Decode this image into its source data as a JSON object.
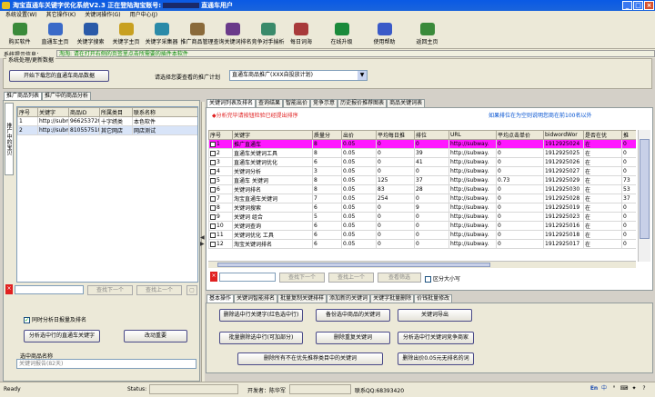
{
  "window": {
    "title": "淘宝直通车关键字优化系统V2.3  正在登陆淘宝账号:",
    "user_label": "直通车用户"
  },
  "menu": [
    "系统设置(W)",
    "其它操作(K)",
    "关键词操作(G)",
    "用户中心(J)"
  ],
  "toolbar": [
    {
      "label": "购买软件",
      "icon": "shopping-cart-icon",
      "color": "#3a8a3a"
    },
    {
      "label": "直通车主页",
      "icon": "home-icon",
      "color": "#3a6ac8"
    },
    {
      "label": "关键字搜索",
      "icon": "search-icon",
      "color": "#2a5aa8"
    },
    {
      "label": "关键字主页",
      "icon": "key-icon",
      "color": "#c8a020"
    },
    {
      "label": "关键字采集器",
      "icon": "collector-icon",
      "color": "#2a8aa8"
    },
    {
      "label": "推广商品管理",
      "icon": "product-icon",
      "color": "#8a6a3a"
    },
    {
      "label": "查询关键词排名",
      "icon": "rank-icon",
      "color": "#6a3a8a"
    },
    {
      "label": "竞争对手揣析",
      "icon": "competitor-icon",
      "color": "#3a8a6a"
    },
    {
      "label": "每日词海",
      "icon": "dictionary-icon",
      "color": "#a83a3a"
    },
    {
      "label": "在线升级",
      "icon": "upgrade-icon",
      "color": "#1a8a3a"
    },
    {
      "label": "使用帮助",
      "icon": "help-icon",
      "color": "#3a5ac8"
    },
    {
      "label": "返回主页",
      "icon": "return-home-icon",
      "color": "#3a8a3a"
    }
  ],
  "infobar": {
    "label": "系统提示信息：",
    "message": "淘淘: 请在打开右侧的页签里点击所需要的插件本软件"
  },
  "sync_group": {
    "label": "系统处理/更新数据",
    "sync_button": "开始下载您的直通车商品数据",
    "plan_label": "请选择您要查看的推广计划",
    "plan_value": "直通车商品推广(XXX自投放计划)"
  },
  "left_tabs": [
    "推广商品列表",
    "推广中的商品分析"
  ],
  "left_vtab": "推广中的宝贝",
  "product_table": {
    "headers": [
      "序号",
      "关键字",
      "商品ID",
      "所属类目",
      "联系名称"
    ],
    "rows": [
      [
        "1",
        "http://subm",
        "966253720",
        "十字绣类",
        "本色软件"
      ],
      [
        "2",
        "http://subm",
        "810557510",
        "其它网店",
        "网店测试"
      ]
    ]
  },
  "left_search": {
    "prev": "查找下一个",
    "next": "查找上一个"
  },
  "left_controls": {
    "checkbox_label": "同时分析日报量及排名",
    "analyze_button": "分析选中行的直通车关键字",
    "stop_button": "改动重要",
    "selected_label": "选中商品名称",
    "selected_value": "关键词报告(82天)"
  },
  "main_tabs": [
    "关键词列表及排名",
    "查询结果",
    "智能出价",
    "竞争示意",
    "历史报价推荐图表",
    "商品关键词表"
  ],
  "notice_left": "分析完毕请按钮检验已经提出排序",
  "notice_right": "如果排位在为空则说明您商在前100名以外",
  "keyword_table": {
    "headers": [
      "序号",
      "关键字",
      "质量分",
      "出价",
      "平均每日推",
      "排位",
      "URL",
      "平均点击单价",
      "bidwordWor",
      "是否在优",
      "推"
    ],
    "rows": [
      [
        "1",
        "推广直通车",
        "8",
        "0.05",
        "0",
        "0",
        "http://subway.",
        "0",
        "1912925024",
        "在",
        "0"
      ],
      [
        "2",
        "直通车关键词工具",
        "8",
        "0.05",
        "0",
        "39",
        "http://subway.",
        "0",
        "1912925025",
        "在",
        "0"
      ],
      [
        "3",
        "直通车关键词优化",
        "6",
        "0.05",
        "0",
        "41",
        "http://subway.",
        "0",
        "1912925026",
        "在",
        "0"
      ],
      [
        "4",
        "关键词分析",
        "3",
        "0.05",
        "0",
        "0",
        "http://subway.",
        "0",
        "1912925027",
        "在",
        "0"
      ],
      [
        "5",
        "直通车 关键词",
        "8",
        "0.05",
        "125",
        "37",
        "http://subway.",
        "0.73",
        "1912925029",
        "在",
        "73"
      ],
      [
        "6",
        "关键词排名",
        "8",
        "0.05",
        "83",
        "28",
        "http://subway.",
        "0",
        "1912925030",
        "在",
        "53"
      ],
      [
        "7",
        "淘宝直通车关键词",
        "7",
        "0.05",
        "254",
        "0",
        "http://subway.",
        "0",
        "1912925028",
        "在",
        "37"
      ],
      [
        "8",
        "关键词搜索",
        "6",
        "0.05",
        "0",
        "9",
        "http://subway.",
        "0",
        "1912925019",
        "在",
        "0"
      ],
      [
        "9",
        "关键词 组合",
        "5",
        "0.05",
        "0",
        "0",
        "http://subway.",
        "0",
        "1912925023",
        "在",
        "0"
      ],
      [
        "10",
        "关键词查询",
        "6",
        "0.05",
        "0",
        "0",
        "http://subway.",
        "0",
        "1912925016",
        "在",
        "0"
      ],
      [
        "11",
        "关键词优化 工具",
        "6",
        "0.05",
        "0",
        "0",
        "http://subway.",
        "0",
        "1912925018",
        "在",
        "0"
      ],
      [
        "12",
        "淘宝关键词排名",
        "6",
        "0.05",
        "0",
        "0",
        "http://subway.",
        "0",
        "1912925017",
        "在",
        "0"
      ]
    ]
  },
  "main_search": {
    "prev": "查找下一个",
    "next": "查找上一个",
    "filter": "查看筛选",
    "case_label": "区分大小写"
  },
  "ops_tabs": [
    "基本操作",
    "关键词智能排名",
    "批量复制关键排样",
    "添加新的关键词",
    "关键字批量删除",
    "价钱批量修改"
  ],
  "ops_buttons": {
    "delete_selected": "删除选中行关键字(红色选中行)",
    "backup": "备份选中商品的关键词",
    "export": "关键词导出",
    "batch_delete": "批量删除选中行(可加部分)",
    "delete_dup": "删除重复关键词",
    "analyze_competitor": "分析选中行关键词竞争商家",
    "delete_all": "删除所有不在优先推荐类目中的关键词",
    "delete_low": "删除出价0.05元无排名的词"
  },
  "status": {
    "ready": "Ready",
    "status_label": "Status:",
    "dev_label": "开发者：陈华军",
    "contact": "联系QQ:68393420"
  },
  "tray": [
    "En",
    "中",
    "°",
    "⌨",
    "✦",
    "?"
  ]
}
